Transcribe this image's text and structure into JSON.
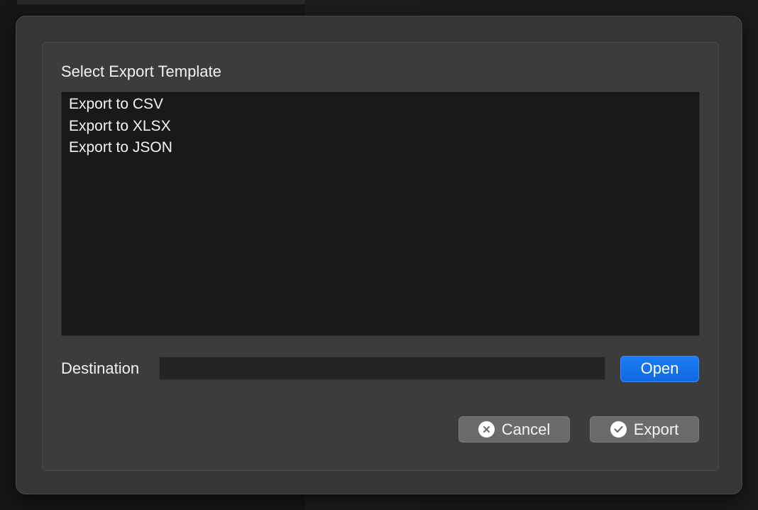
{
  "dialog": {
    "title": "Select Export Template",
    "templates": [
      {
        "label": "Export to CSV"
      },
      {
        "label": "Export to XLSX"
      },
      {
        "label": "Export to JSON"
      }
    ],
    "destination": {
      "label": "Destination",
      "value": "",
      "placeholder": ""
    },
    "buttons": {
      "open": "Open",
      "cancel": "Cancel",
      "export": "Export"
    },
    "icons": {
      "cancel": "close-circle-icon",
      "export": "check-circle-icon"
    },
    "colors": {
      "accent": "#1574ea",
      "button": "#6b6b6b"
    }
  }
}
